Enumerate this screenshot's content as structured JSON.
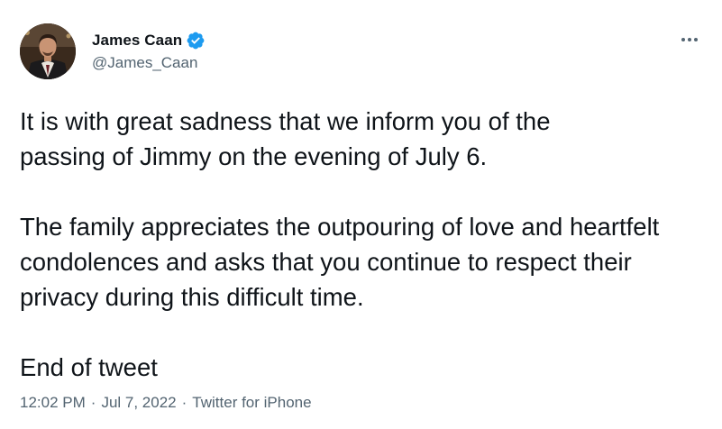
{
  "tweet": {
    "author": {
      "display_name": "James Caan",
      "handle": "@James_Caan",
      "verified": true,
      "verified_icon": "verified-badge-icon",
      "avatar": "avatar"
    },
    "more_icon": "more-options-icon",
    "paragraphs": [
      "It is with great sadness that we inform you of the passing of Jimmy on the evening of July 6.",
      "The family appreciates the outpouring of love and heartfelt condolences and asks that you continue to respect their privacy during this difficult time.",
      "End of tweet"
    ],
    "time": "12:02 PM",
    "date": "Jul 7, 2022",
    "source": "Twitter for iPhone",
    "separator": "·"
  },
  "colors": {
    "text": "#0f1419",
    "secondary": "#536471",
    "verified": "#1d9bf0"
  }
}
